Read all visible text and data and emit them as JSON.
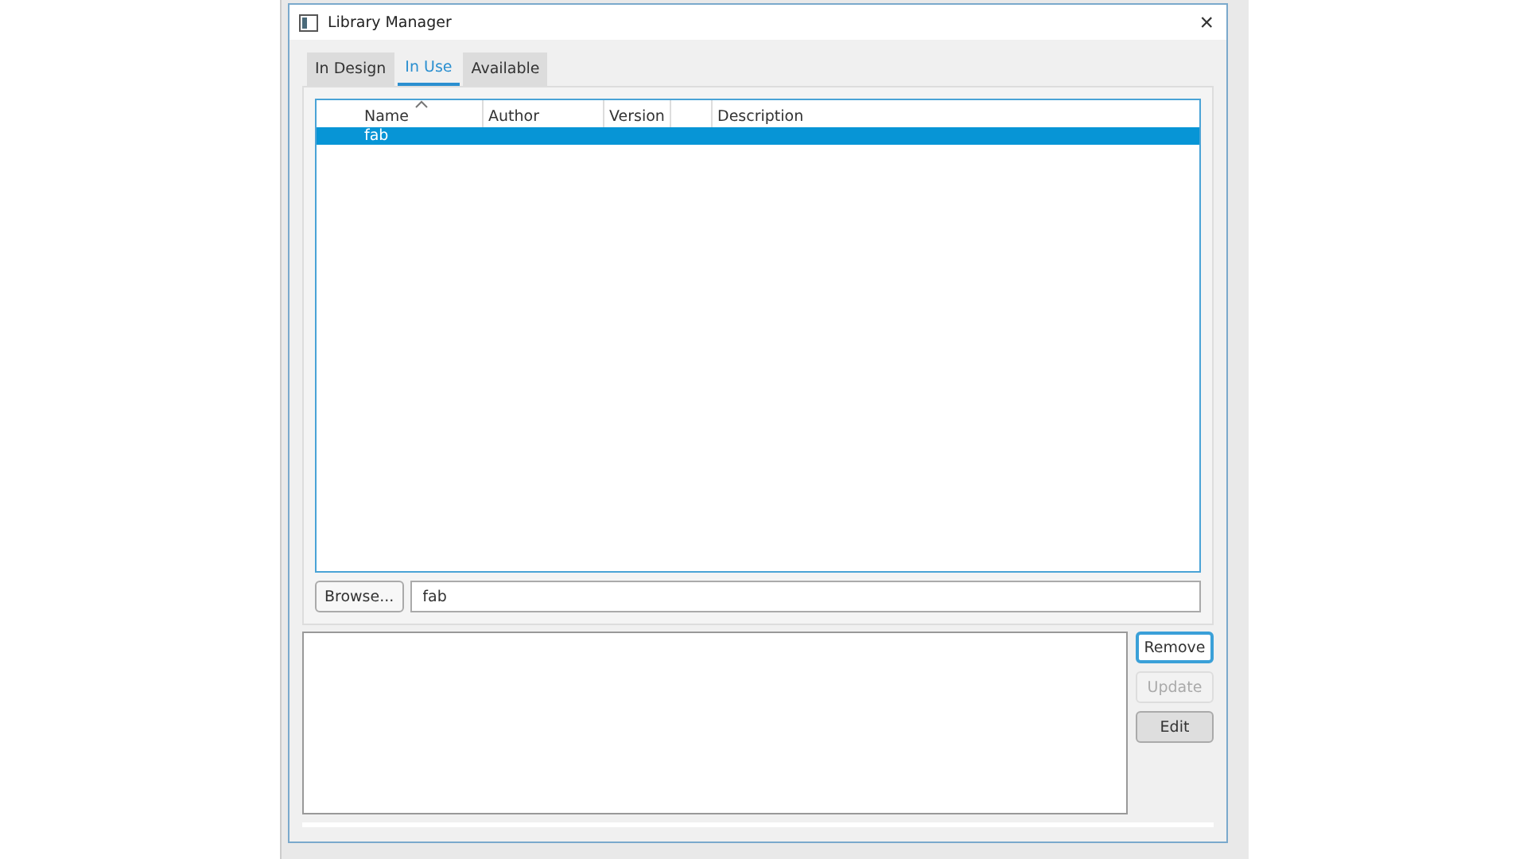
{
  "window": {
    "title": "Library Manager",
    "close": "×"
  },
  "tabs": [
    {
      "label": "In Design",
      "selected": false
    },
    {
      "label": "In Use",
      "selected": true
    },
    {
      "label": "Available",
      "selected": false
    }
  ],
  "table": {
    "columns": [
      {
        "label": "Name",
        "sorted": true
      },
      {
        "label": "Author",
        "sorted": false
      },
      {
        "label": "Version",
        "sorted": false
      },
      {
        "label": "Description",
        "sorted": false
      }
    ],
    "rows": [
      {
        "cells": [
          "fab"
        ],
        "selected": true
      }
    ]
  },
  "browse_button": "Browse...",
  "path_field": {
    "value": "fab"
  },
  "buttons": [
    {
      "label": "Remove",
      "disabled": false,
      "focused": true
    },
    {
      "label": "Update",
      "disabled": true,
      "focused": false
    },
    {
      "label": "Edit",
      "disabled": false,
      "focused": false
    }
  ]
}
